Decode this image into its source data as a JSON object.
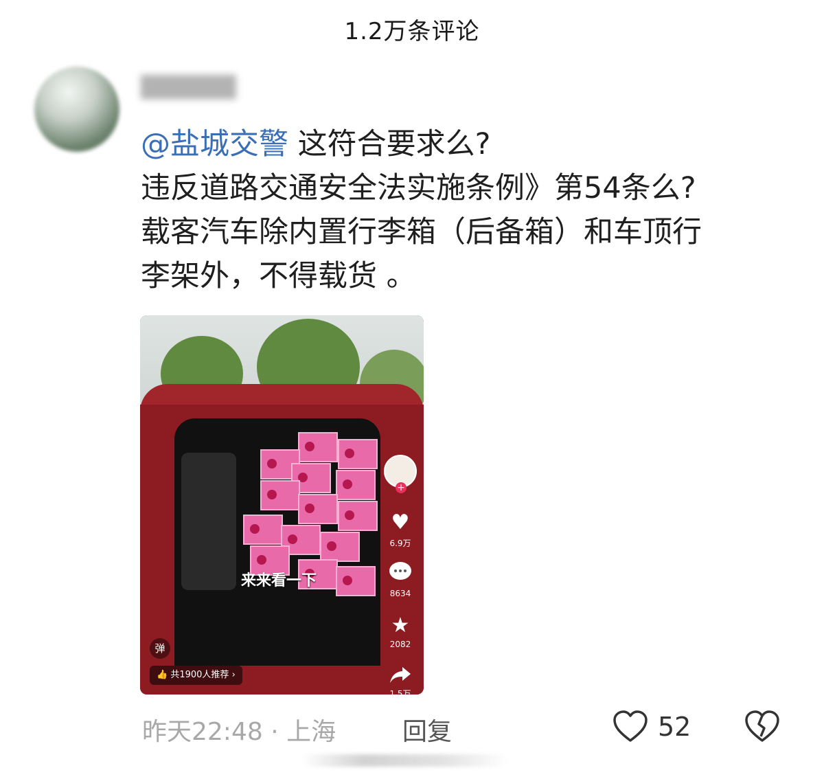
{
  "header": {
    "title": "1.2万条评论"
  },
  "comment": {
    "mention": "@盐城交警",
    "lines": [
      " 这符合要求么?",
      "违反道路交通安全法实施条例》第54条么?",
      "载客汽车除内置行李箱（后备箱）和车顶行",
      "李架外，不得载货 。"
    ]
  },
  "video": {
    "caption": "来来看一下",
    "likes": "6.9万",
    "comments": "8634",
    "favorites": "2082",
    "shares": "1.5万",
    "danmaku": "弹",
    "recommend": "共1900人推荐",
    "colors": {
      "car": "#a1262c",
      "box": "#e86aa8"
    }
  },
  "meta": {
    "time": "昨天22:48",
    "separator": "·",
    "location": "上海",
    "reply_label": "回复",
    "like_count": "52"
  },
  "icons": [
    "heart-icon",
    "broken-heart-icon",
    "comment-icon",
    "star-icon",
    "share-icon",
    "thumbs-up-icon",
    "chevron-right-icon"
  ]
}
